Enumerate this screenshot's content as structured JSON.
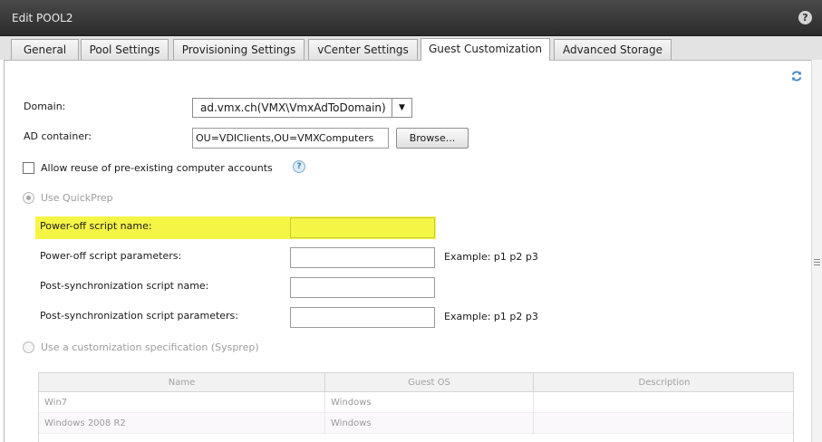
{
  "window": {
    "title": "Edit POOL2",
    "help_symbol": "?"
  },
  "tabs": [
    {
      "label": "General",
      "active": false
    },
    {
      "label": "Pool Settings",
      "active": false
    },
    {
      "label": "Provisioning Settings",
      "active": false
    },
    {
      "label": "vCenter Settings",
      "active": false
    },
    {
      "label": "Guest Customization",
      "active": true
    },
    {
      "label": "Advanced Storage",
      "active": false
    }
  ],
  "form": {
    "domain_label": "Domain:",
    "domain_value": "ad.vmx.ch(VMX\\VmxAdToDomain)",
    "ad_container_label": "AD container:",
    "ad_container_value": "OU=VDIClients,OU=VMXComputers",
    "browse_label": "Browse...",
    "allow_reuse_label": "Allow reuse of pre-existing computer accounts",
    "allow_reuse_checked": false,
    "quickprep_label": "Use QuickPrep",
    "quickprep_selected": true,
    "poweroff_script_name_label": "Power-off script name:",
    "poweroff_script_name_value": "",
    "poweroff_script_params_label": "Power-off script parameters:",
    "poweroff_script_params_value": "",
    "poweroff_example": "Example: p1 p2 p3",
    "postsync_script_name_label": "Post-synchronization script name:",
    "postsync_script_name_value": "",
    "postsync_script_params_label": "Post-synchronization script parameters:",
    "postsync_script_params_value": "",
    "postsync_example": "Example: p1 p2 p3",
    "sysprep_label": "Use a customization specification (Sysprep)",
    "sysprep_selected": false
  },
  "spec_table": {
    "columns": [
      "Name",
      "Guest OS",
      "Description"
    ],
    "rows": [
      {
        "name": "Win7",
        "os": "Windows",
        "description": ""
      },
      {
        "name": "Windows 2008 R2",
        "os": "Windows",
        "description": ""
      }
    ]
  },
  "colors": {
    "highlight": "#f5f546",
    "titlebar": "#3a3a3a",
    "disabled_text": "#9c9c9c"
  },
  "icons": {
    "help": "help-icon",
    "refresh": "refresh-icon",
    "info": "info-icon",
    "dropdown": "chevron-down-icon"
  }
}
